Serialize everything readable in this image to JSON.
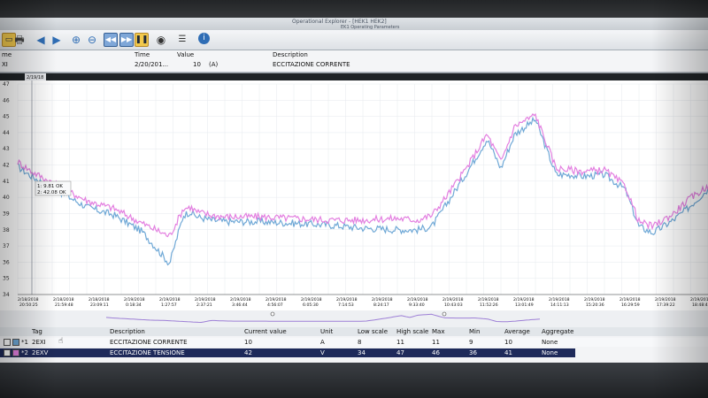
{
  "window": {
    "title": "Operational Explorer - [HEK1 HEK2]",
    "subtitle": "EK1 Operating Parameters"
  },
  "toolbar": {
    "icons": [
      "save-icon",
      "print-icon",
      "arrow-left-icon",
      "arrow-right-icon",
      "zoom-in-icon",
      "zoom-out-icon",
      "rewind-icon",
      "fast-forward-icon",
      "pause-icon",
      "eye-icon",
      "list-icon",
      "info-icon"
    ]
  },
  "header": {
    "col_name": "me",
    "col_time": "Time",
    "col_value": "Value",
    "col_description": "Description",
    "row_tag": "XI",
    "row_time": "2/20/201...",
    "row_value": "10",
    "row_unit": "(A)",
    "row_description": "ECCITAZIONE CORRENTE"
  },
  "chart_data": {
    "type": "line",
    "cursor_time_label": "2/19/18",
    "y_ticks": [
      "47",
      "46",
      "45",
      "44",
      "43",
      "42",
      "41",
      "40",
      "39",
      "38",
      "37",
      "36",
      "35",
      "34"
    ],
    "y_range": [
      34,
      47
    ],
    "legend_box": [
      "1: 9.81 OK",
      "2: 42.08 OK"
    ],
    "x_tick_dates": [
      "2/18/2018",
      "2/18/2018",
      "2/18/2018",
      "2/19/2018",
      "2/19/2018",
      "2/19/2018",
      "2/19/2018",
      "2/19/2018",
      "2/19/2018",
      "2/19/2018",
      "2/19/2018",
      "2/19/2018",
      "2/19/2018",
      "2/19/2018",
      "2/19/2018",
      "2/19/2018",
      "2/19/2018",
      "2/19/2018",
      "2/19/2018",
      "2/19/2018"
    ],
    "x_tick_times": [
      "20:50:25",
      "21:59:48",
      "23:09:11",
      "0:18:34",
      "1:27:57",
      "2:37:21",
      "3:46:44",
      "4:56:07",
      "6:05:30",
      "7:14:53",
      "8:24:17",
      "9:33:40",
      "10:43:03",
      "11:52:26",
      "13:01:49",
      "14:11:13",
      "15:20:36",
      "16:29:59",
      "17:39:22",
      "18:48:45"
    ],
    "series": [
      {
        "color": "#6fa8d6",
        "x": [
          0,
          2,
          5,
          10,
          14,
          18,
          22,
          24,
          25,
          26,
          28,
          30,
          35,
          40,
          45,
          50,
          55,
          58,
          60,
          62,
          65,
          68,
          70,
          72,
          75,
          78,
          80,
          82,
          85,
          88,
          90,
          92,
          95,
          97,
          100
        ],
        "values": [
          41.9,
          41.3,
          40.6,
          39.4,
          38.9,
          37.9,
          35.9,
          38.9,
          39.1,
          38.8,
          38.6,
          38.5,
          38.5,
          38.4,
          38.3,
          38.1,
          38.0,
          38.0,
          38.2,
          39.5,
          41.5,
          43.6,
          41.8,
          43.9,
          44.8,
          41.4,
          41.4,
          41.3,
          41.4,
          40.5,
          38.2,
          37.8,
          38.6,
          39.3,
          40.5
        ]
      },
      {
        "color": "#e37fe0",
        "x": [
          0,
          2,
          5,
          10,
          14,
          18,
          22,
          24,
          25,
          26,
          28,
          30,
          35,
          40,
          45,
          50,
          55,
          58,
          60,
          62,
          65,
          68,
          70,
          72,
          75,
          78,
          80,
          82,
          85,
          88,
          90,
          92,
          95,
          97,
          100
        ],
        "values": [
          42.2,
          41.6,
          40.9,
          39.8,
          39.3,
          38.4,
          37.6,
          39.3,
          39.4,
          39.1,
          38.9,
          38.8,
          38.8,
          38.7,
          38.6,
          38.6,
          38.7,
          38.6,
          38.9,
          40.0,
          41.8,
          43.9,
          42.2,
          44.4,
          45.1,
          41.8,
          41.7,
          41.6,
          41.7,
          40.7,
          38.5,
          38.2,
          39.0,
          39.8,
          40.7
        ]
      }
    ]
  },
  "table": {
    "headers": {
      "tag": "Tag",
      "description": "Description",
      "current": "Current value",
      "unit": "Unit",
      "low": "Low scale",
      "high": "High scale",
      "max": "Max",
      "min": "Min",
      "avg": "Average",
      "aggregate": "Aggregate"
    },
    "rows": [
      {
        "index": "*1",
        "tag": "2EXI",
        "description": "ECCITAZIONE CORRENTE",
        "current": "10",
        "unit": "A",
        "low": "8",
        "high": "11",
        "max": "11",
        "min": "9",
        "avg": "10",
        "aggregate": "None"
      },
      {
        "index": "*2",
        "tag": "2EXV",
        "description": "ECCITAZIONE TENSIONE",
        "current": "42",
        "unit": "V",
        "low": "34",
        "high": "47",
        "max": "46",
        "min": "36",
        "avg": "41",
        "aggregate": "None"
      }
    ]
  }
}
